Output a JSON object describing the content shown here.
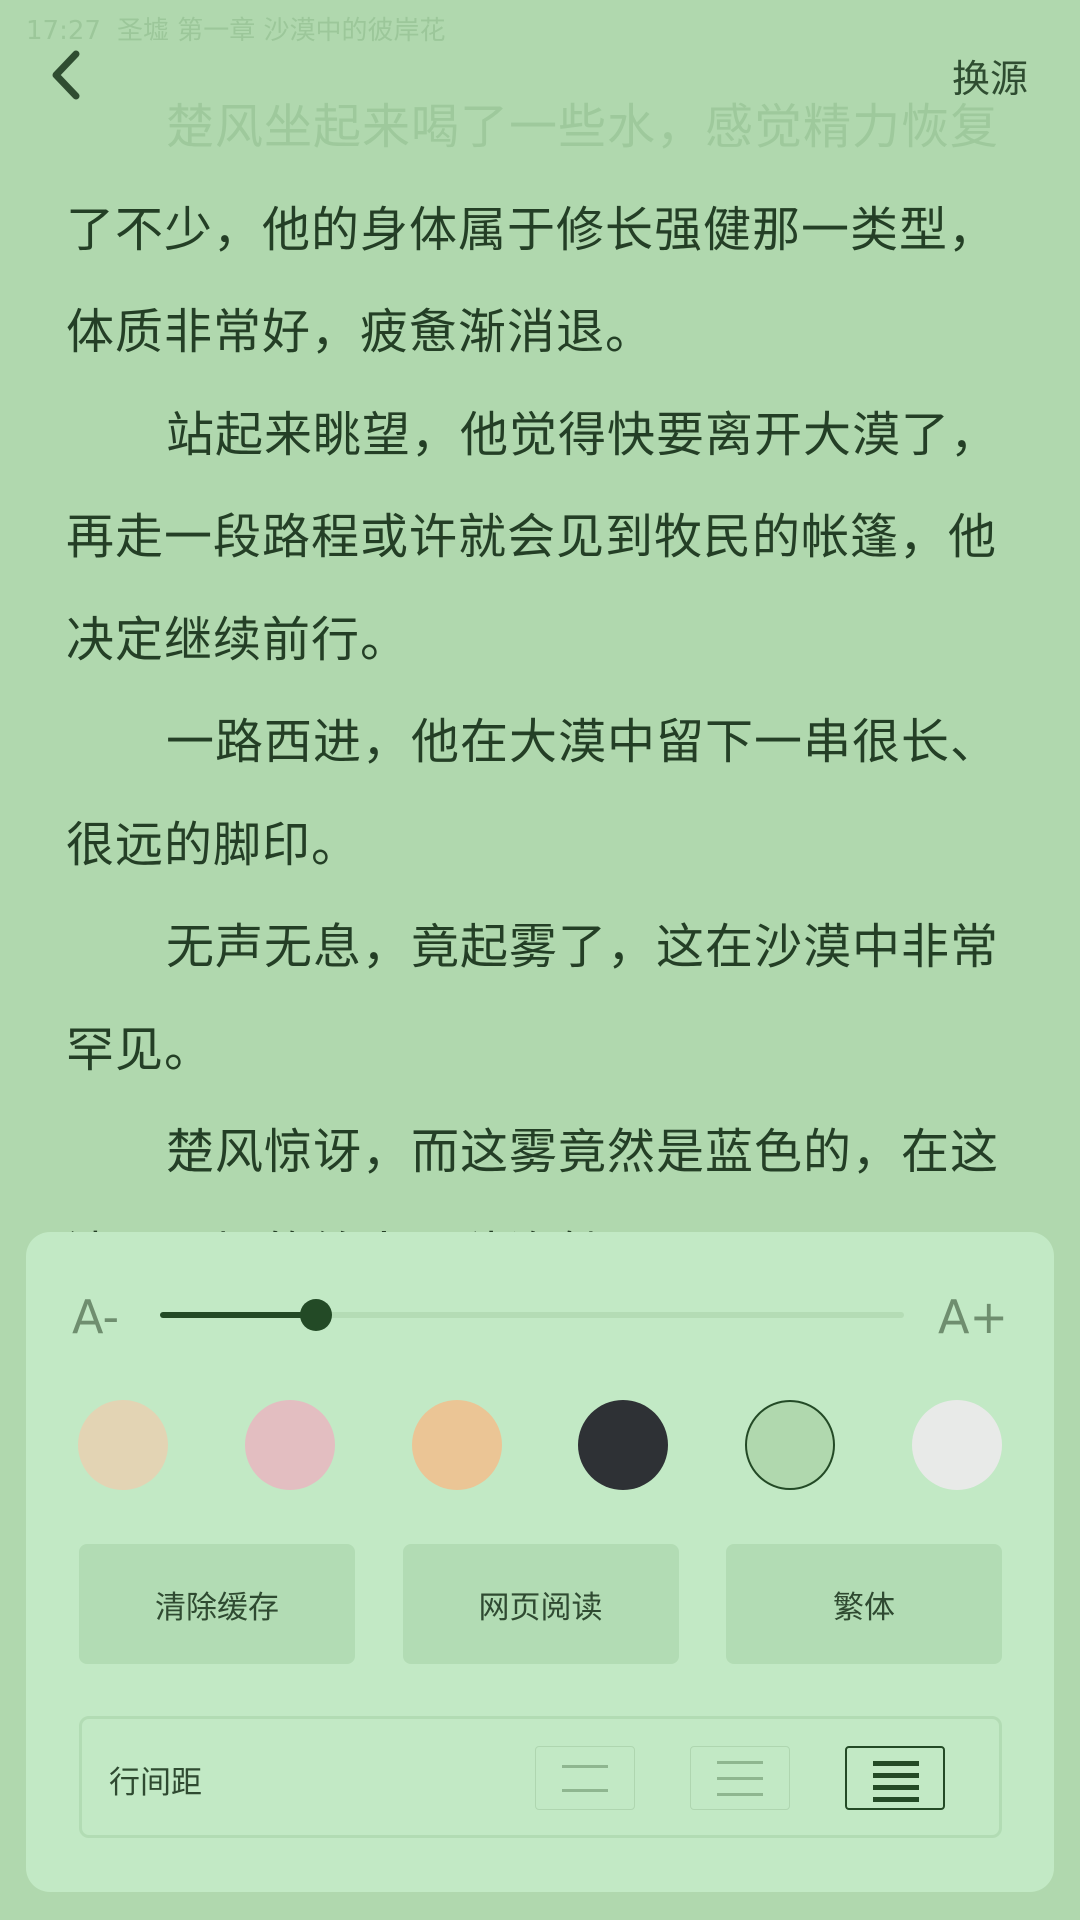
{
  "status": {
    "time": "17:27",
    "chapter": "圣墟 第一章 沙漠中的彼岸花"
  },
  "header": {
    "back_icon": "chevron-left-icon",
    "source_label": "换源"
  },
  "reader": {
    "first_line_faded": "楚风坐起来喝了一些水，感觉精力恢复",
    "first_paragraph_rest": "了不少，他的身体属于修长强健那一类型，体质非常好，疲惫渐消退。",
    "paragraphs": [
      "站起来眺望，他觉得快要离开大漠了，再走一段路程或许就会见到牧民的帐篷，他决定继续前行。",
      "一路西进，他在大漠中留下一串很长、很远的脚印。",
      "无声无息，竟起雾了，这在沙漠中非常罕见。",
      "楚风惊讶，而这雾竟然是蓝色的，在这漆黑平坦的给人一种诡魅"
    ]
  },
  "settings": {
    "font_decrease_label": "A-",
    "font_increase_label": "A+",
    "font_size_level": 0.21,
    "colors": [
      {
        "name": "cream",
        "hex": "#e3d4b4",
        "selected": false
      },
      {
        "name": "pink",
        "hex": "#e3bec1",
        "selected": false
      },
      {
        "name": "orange",
        "hex": "#ebc595",
        "selected": false
      },
      {
        "name": "dark",
        "hex": "#2e3135",
        "selected": false
      },
      {
        "name": "green",
        "hex": "#b0d8ae",
        "selected": true
      },
      {
        "name": "light-gray",
        "hex": "#e8eae8",
        "selected": false
      }
    ],
    "actions": {
      "clear_cache": "清除缓存",
      "web_read": "网页阅读",
      "traditional": "繁体"
    },
    "line_spacing": {
      "label": "行间距",
      "selected": "large"
    }
  }
}
